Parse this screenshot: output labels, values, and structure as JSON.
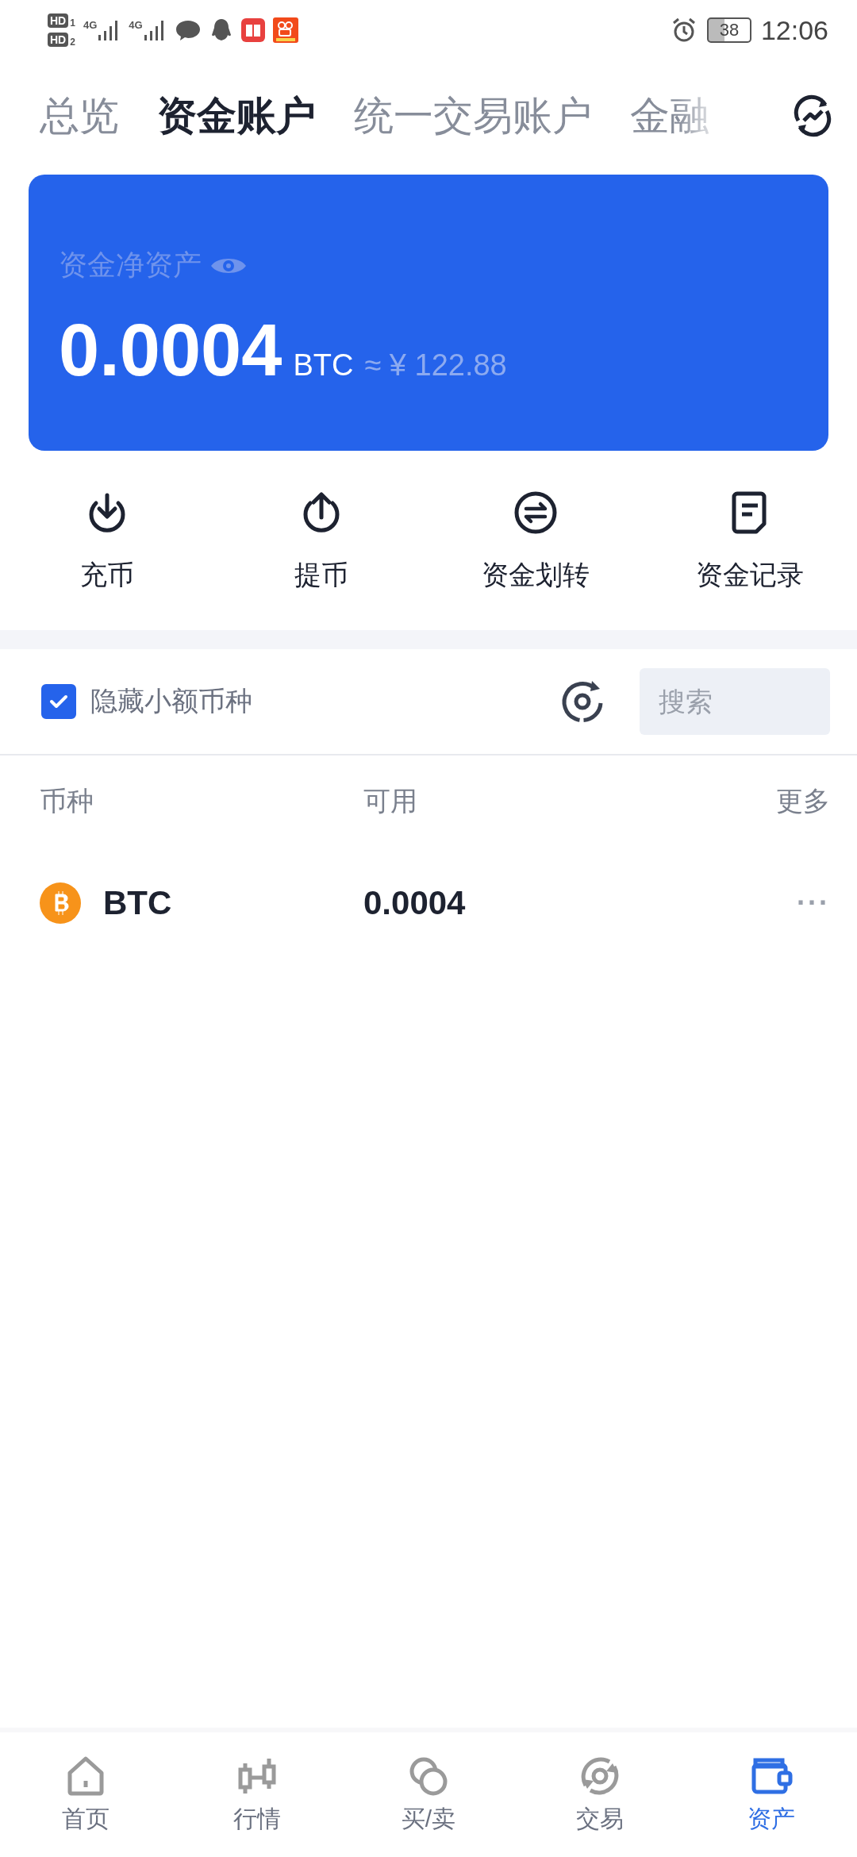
{
  "status_bar": {
    "hd": [
      {
        "label": "HD",
        "index": "1"
      },
      {
        "label": "HD",
        "index": "2"
      }
    ],
    "networks": [
      {
        "label": "4G"
      },
      {
        "label": "4G"
      }
    ],
    "battery": "38",
    "time": "12:06"
  },
  "tabs": [
    {
      "label": "总览",
      "selected": false
    },
    {
      "label": "资金账户",
      "selected": true
    },
    {
      "label": "统一交易账户",
      "selected": false
    },
    {
      "label": "金融",
      "selected": false
    }
  ],
  "balance_card": {
    "label": "资金净资产",
    "amount": "0.0004",
    "unit": "BTC",
    "fiat": "≈ ¥ 122.88"
  },
  "actions": [
    {
      "kind": "deposit",
      "label": "充币"
    },
    {
      "kind": "withdraw",
      "label": "提币"
    },
    {
      "kind": "transfer",
      "label": "资金划转"
    },
    {
      "kind": "records",
      "label": "资金记录"
    }
  ],
  "filter": {
    "hide_small": {
      "label": "隐藏小额币种",
      "checked": true
    },
    "search": {
      "placeholder": "搜索"
    }
  },
  "table": {
    "columns": [
      "币种",
      "可用",
      "更多"
    ],
    "rows": [
      {
        "coin": "BTC",
        "available": "0.0004",
        "more": "···"
      }
    ]
  },
  "bottom_nav": [
    {
      "kind": "home",
      "label": "首页",
      "selected": false
    },
    {
      "kind": "market",
      "label": "行情",
      "selected": false
    },
    {
      "kind": "buysell",
      "label": "买/卖",
      "selected": false
    },
    {
      "kind": "trade",
      "label": "交易",
      "selected": false
    },
    {
      "kind": "assets",
      "label": "资产",
      "selected": true
    }
  ]
}
